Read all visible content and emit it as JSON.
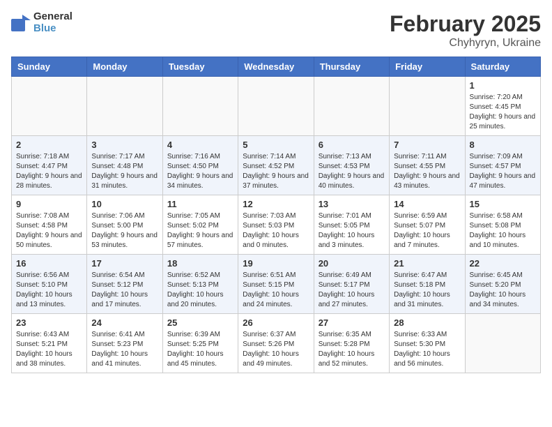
{
  "header": {
    "logo_line1": "General",
    "logo_line2": "Blue",
    "month_year": "February 2025",
    "location": "Chyhyryn, Ukraine"
  },
  "weekdays": [
    "Sunday",
    "Monday",
    "Tuesday",
    "Wednesday",
    "Thursday",
    "Friday",
    "Saturday"
  ],
  "weeks": [
    [
      {
        "day": "",
        "info": ""
      },
      {
        "day": "",
        "info": ""
      },
      {
        "day": "",
        "info": ""
      },
      {
        "day": "",
        "info": ""
      },
      {
        "day": "",
        "info": ""
      },
      {
        "day": "",
        "info": ""
      },
      {
        "day": "1",
        "info": "Sunrise: 7:20 AM\nSunset: 4:45 PM\nDaylight: 9 hours and 25 minutes."
      }
    ],
    [
      {
        "day": "2",
        "info": "Sunrise: 7:18 AM\nSunset: 4:47 PM\nDaylight: 9 hours and 28 minutes."
      },
      {
        "day": "3",
        "info": "Sunrise: 7:17 AM\nSunset: 4:48 PM\nDaylight: 9 hours and 31 minutes."
      },
      {
        "day": "4",
        "info": "Sunrise: 7:16 AM\nSunset: 4:50 PM\nDaylight: 9 hours and 34 minutes."
      },
      {
        "day": "5",
        "info": "Sunrise: 7:14 AM\nSunset: 4:52 PM\nDaylight: 9 hours and 37 minutes."
      },
      {
        "day": "6",
        "info": "Sunrise: 7:13 AM\nSunset: 4:53 PM\nDaylight: 9 hours and 40 minutes."
      },
      {
        "day": "7",
        "info": "Sunrise: 7:11 AM\nSunset: 4:55 PM\nDaylight: 9 hours and 43 minutes."
      },
      {
        "day": "8",
        "info": "Sunrise: 7:09 AM\nSunset: 4:57 PM\nDaylight: 9 hours and 47 minutes."
      }
    ],
    [
      {
        "day": "9",
        "info": "Sunrise: 7:08 AM\nSunset: 4:58 PM\nDaylight: 9 hours and 50 minutes."
      },
      {
        "day": "10",
        "info": "Sunrise: 7:06 AM\nSunset: 5:00 PM\nDaylight: 9 hours and 53 minutes."
      },
      {
        "day": "11",
        "info": "Sunrise: 7:05 AM\nSunset: 5:02 PM\nDaylight: 9 hours and 57 minutes."
      },
      {
        "day": "12",
        "info": "Sunrise: 7:03 AM\nSunset: 5:03 PM\nDaylight: 10 hours and 0 minutes."
      },
      {
        "day": "13",
        "info": "Sunrise: 7:01 AM\nSunset: 5:05 PM\nDaylight: 10 hours and 3 minutes."
      },
      {
        "day": "14",
        "info": "Sunrise: 6:59 AM\nSunset: 5:07 PM\nDaylight: 10 hours and 7 minutes."
      },
      {
        "day": "15",
        "info": "Sunrise: 6:58 AM\nSunset: 5:08 PM\nDaylight: 10 hours and 10 minutes."
      }
    ],
    [
      {
        "day": "16",
        "info": "Sunrise: 6:56 AM\nSunset: 5:10 PM\nDaylight: 10 hours and 13 minutes."
      },
      {
        "day": "17",
        "info": "Sunrise: 6:54 AM\nSunset: 5:12 PM\nDaylight: 10 hours and 17 minutes."
      },
      {
        "day": "18",
        "info": "Sunrise: 6:52 AM\nSunset: 5:13 PM\nDaylight: 10 hours and 20 minutes."
      },
      {
        "day": "19",
        "info": "Sunrise: 6:51 AM\nSunset: 5:15 PM\nDaylight: 10 hours and 24 minutes."
      },
      {
        "day": "20",
        "info": "Sunrise: 6:49 AM\nSunset: 5:17 PM\nDaylight: 10 hours and 27 minutes."
      },
      {
        "day": "21",
        "info": "Sunrise: 6:47 AM\nSunset: 5:18 PM\nDaylight: 10 hours and 31 minutes."
      },
      {
        "day": "22",
        "info": "Sunrise: 6:45 AM\nSunset: 5:20 PM\nDaylight: 10 hours and 34 minutes."
      }
    ],
    [
      {
        "day": "23",
        "info": "Sunrise: 6:43 AM\nSunset: 5:21 PM\nDaylight: 10 hours and 38 minutes."
      },
      {
        "day": "24",
        "info": "Sunrise: 6:41 AM\nSunset: 5:23 PM\nDaylight: 10 hours and 41 minutes."
      },
      {
        "day": "25",
        "info": "Sunrise: 6:39 AM\nSunset: 5:25 PM\nDaylight: 10 hours and 45 minutes."
      },
      {
        "day": "26",
        "info": "Sunrise: 6:37 AM\nSunset: 5:26 PM\nDaylight: 10 hours and 49 minutes."
      },
      {
        "day": "27",
        "info": "Sunrise: 6:35 AM\nSunset: 5:28 PM\nDaylight: 10 hours and 52 minutes."
      },
      {
        "day": "28",
        "info": "Sunrise: 6:33 AM\nSunset: 5:30 PM\nDaylight: 10 hours and 56 minutes."
      },
      {
        "day": "",
        "info": ""
      }
    ]
  ]
}
